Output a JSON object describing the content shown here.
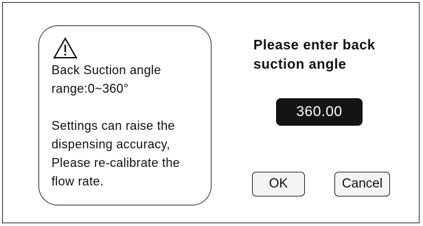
{
  "dialog": {
    "info": {
      "icon": "warning-triangle-icon",
      "range_line1": "Back Suction angle",
      "range_line2": "range:0~360°",
      "note_line1": "Settings  can raise the",
      "note_line2": "dispensing accuracy,",
      "note_line3": "Please re-calibrate the",
      "note_line4": "flow rate."
    },
    "prompt_line1": "Please enter back",
    "prompt_line2": "suction angle",
    "angle_value": "360.00",
    "ok_label": "OK",
    "cancel_label": "Cancel",
    "colors": {
      "value_box_bg": "#141414",
      "value_text": "#ffffff",
      "border": "#222222"
    }
  }
}
